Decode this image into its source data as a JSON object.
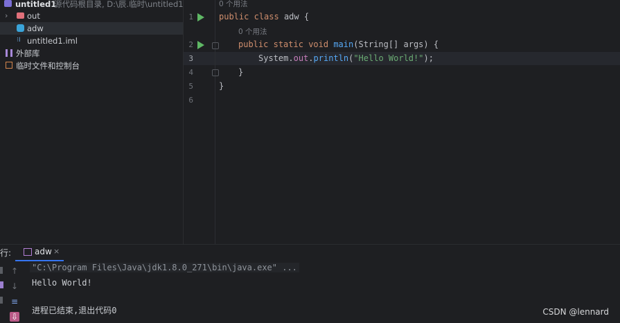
{
  "project_tree": {
    "root": {
      "name": "untitled1",
      "path_hint": "源代码根目录, D:\\辰.临时\\untitled1"
    },
    "items": [
      {
        "label": "out"
      },
      {
        "label": "adw"
      },
      {
        "label": "untitled1.iml"
      },
      {
        "label": "外部库"
      },
      {
        "label": "临时文件和控制台"
      }
    ]
  },
  "editor": {
    "usage_hint_class": "0 个用法",
    "usage_hint_method": "0 个用法",
    "line_numbers": [
      "1",
      "2",
      "3",
      "4",
      "5",
      "6"
    ],
    "lines": {
      "l1": {
        "kw1": "public",
        "kw2": "class",
        "name": "adw",
        "brace": "{"
      },
      "l2": {
        "kw1": "public",
        "kw2": "static",
        "kw3": "void",
        "name": "main",
        "params_open": "(",
        "type": "String[]",
        "param": "args",
        "params_close": ")",
        "brace": "{"
      },
      "l3": {
        "cls": "System",
        "dot1": ".",
        "field": "out",
        "dot2": ".",
        "method": "println",
        "open": "(",
        "str": "\"Hello World!\"",
        "close": ");"
      },
      "l4": {
        "brace": "}"
      },
      "l5": {
        "brace": "}"
      }
    }
  },
  "run_window": {
    "title": "行:",
    "tab_label": "adw",
    "tab_close": "×",
    "output": [
      "\"C:\\Program Files\\Java\\jdk1.8.0_271\\bin\\java.exe\" ...",
      "Hello World!",
      "",
      "进程已结束,退出代码0"
    ]
  },
  "watermark": "CSDN @lennard",
  "colors": {
    "accent": "#3574f0",
    "run_green": "#5fb865",
    "keyword": "#cf8e6d",
    "method": "#56a8f5",
    "string": "#6aab73",
    "field": "#c77dbb"
  }
}
